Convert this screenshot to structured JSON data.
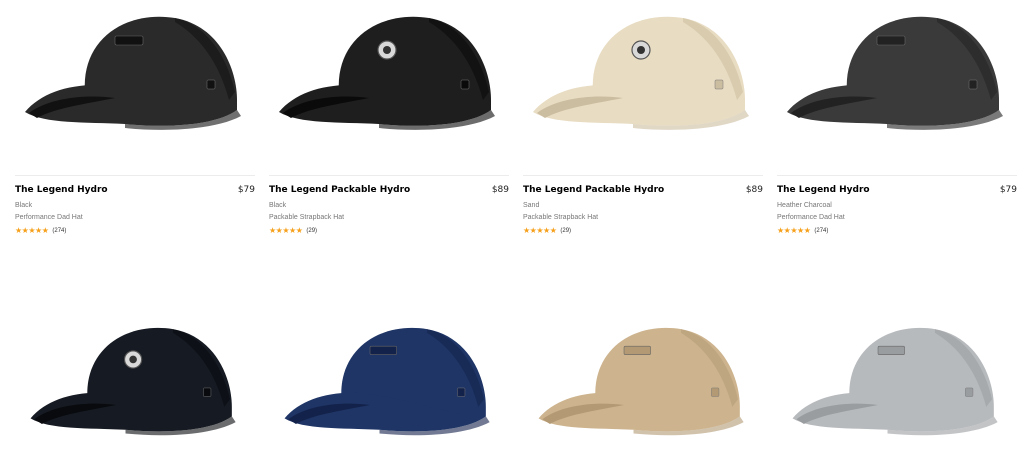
{
  "products": [
    {
      "title": "The Legend Hydro",
      "price": "$79",
      "color": "Black",
      "type": "Performance Dad Hat",
      "stars": "★★★★★",
      "reviews": "(274)",
      "hat_color": "#2a2a2a",
      "hat_dark": "#111111",
      "badge": "patch"
    },
    {
      "title": "The Legend Packable Hydro",
      "price": "$89",
      "color": "Black",
      "type": "Packable Strapback Hat",
      "stars": "★★★★★",
      "reviews": "(29)",
      "hat_color": "#1e1e1e",
      "hat_dark": "#0a0a0a",
      "badge": "round"
    },
    {
      "title": "The Legend Packable Hydro",
      "price": "$89",
      "color": "Sand",
      "type": "Packable Strapback Hat",
      "stars": "★★★★★",
      "reviews": "(29)",
      "hat_color": "#e8dcc2",
      "hat_dark": "#cbbd9f",
      "badge": "round"
    },
    {
      "title": "The Legend Hydro",
      "price": "$79",
      "color": "Heather Charcoal",
      "type": "Performance Dad Hat",
      "stars": "★★★★★",
      "reviews": "(274)",
      "hat_color": "#3a3a3a",
      "hat_dark": "#222222",
      "badge": "patch"
    },
    {
      "hat_color": "#161a22",
      "hat_dark": "#080a0e",
      "badge": "round"
    },
    {
      "hat_color": "#1f3566",
      "hat_dark": "#13224a",
      "badge": "patch"
    },
    {
      "hat_color": "#cdb48e",
      "hat_dark": "#b39a74",
      "badge": "patch"
    },
    {
      "hat_color": "#b7babd",
      "hat_dark": "#9a9da0",
      "badge": "patch"
    }
  ],
  "icons": {
    "star": "star-icon",
    "hat": "cap-image"
  }
}
